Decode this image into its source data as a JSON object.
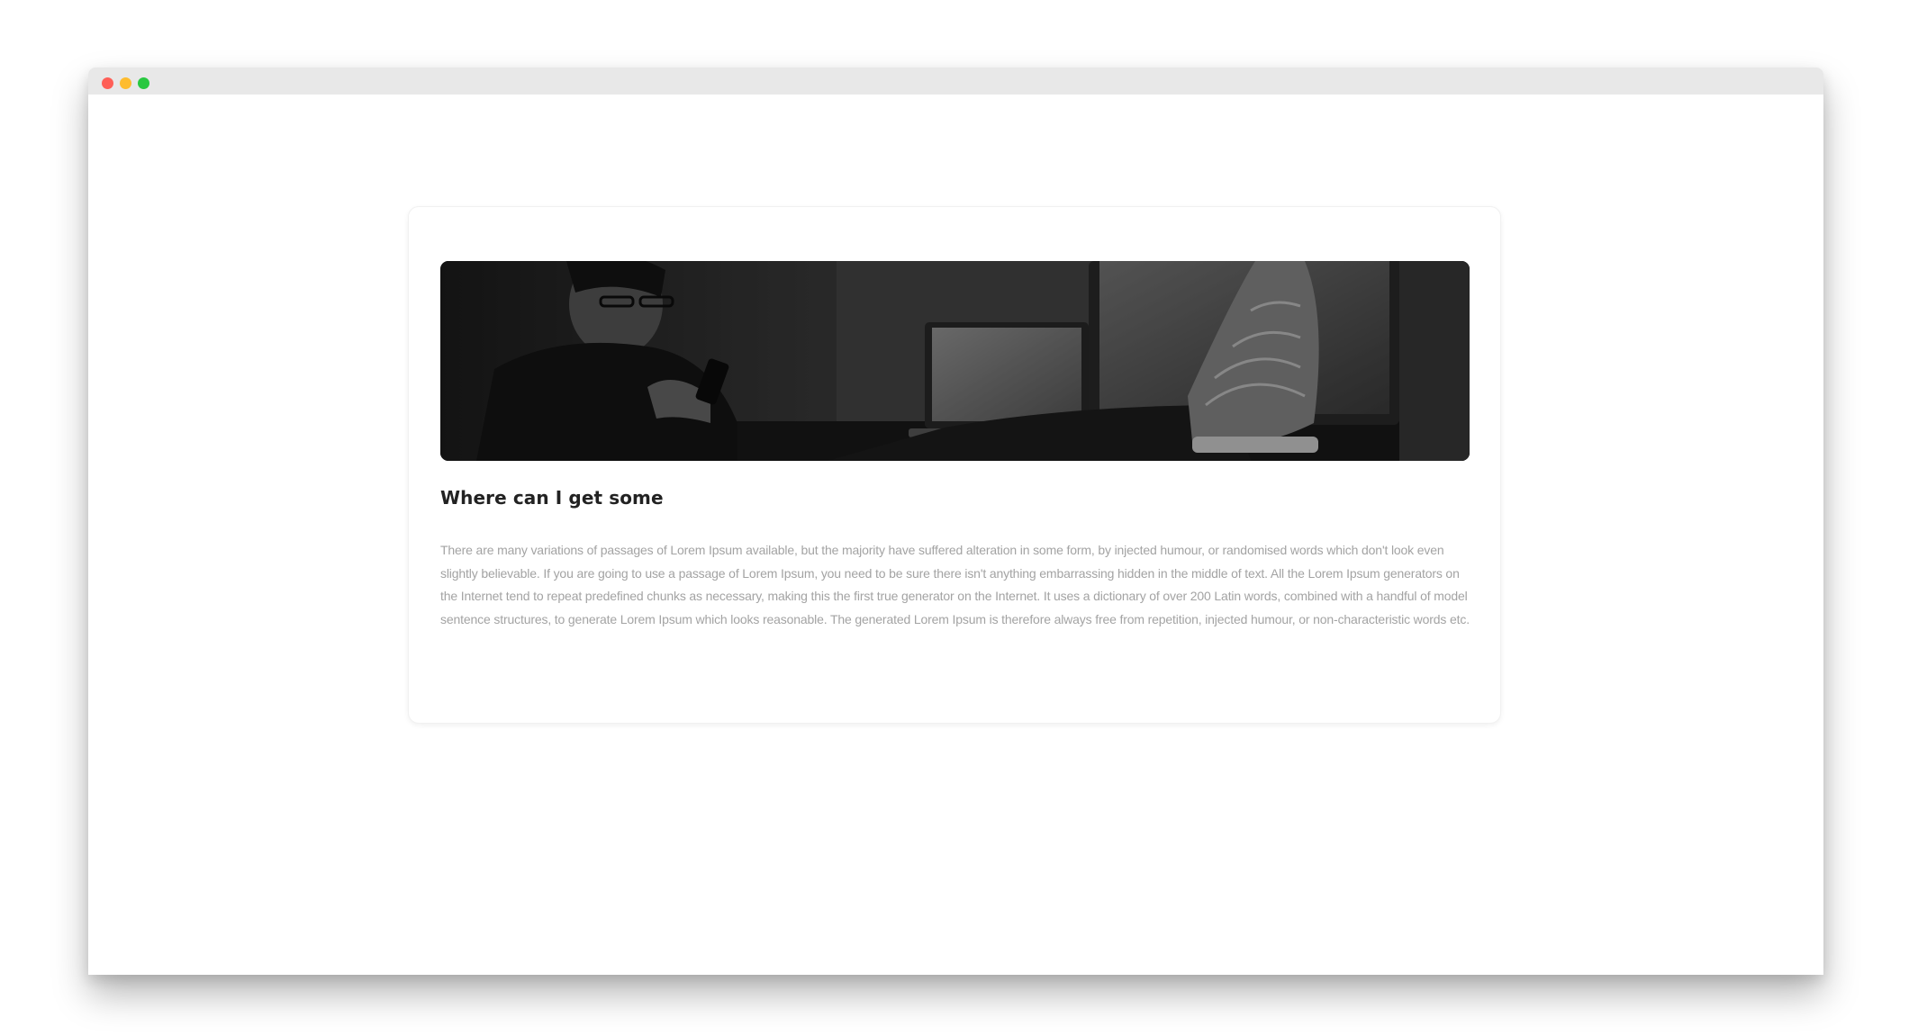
{
  "window": {
    "controls": {
      "close_color": "#ff5f57",
      "minimize_color": "#febc2e",
      "maximize_color": "#28c840"
    },
    "titlebar_color": "#e8e8e8"
  },
  "card": {
    "image_description_icon": "photo-icon",
    "title": "Where can I get some",
    "body": "There are many variations of passages of Lorem Ipsum available, but the majority have suffered alteration in some form, by injected humour, or randomised words which don't look even slightly believable. If you are going to use a passage of Lorem Ipsum, you need to be sure there isn't anything embarrassing hidden in the middle of text. All the Lorem Ipsum generators on the Internet tend to repeat predefined chunks as necessary, making this the first true generator on the Internet. It uses a dictionary of over 200 Latin words, combined with a handful of model sentence structures, to generate Lorem Ipsum which looks reasonable. The generated Lorem Ipsum is therefore always free from repetition, injected humour, or non-characteristic words etc."
  }
}
